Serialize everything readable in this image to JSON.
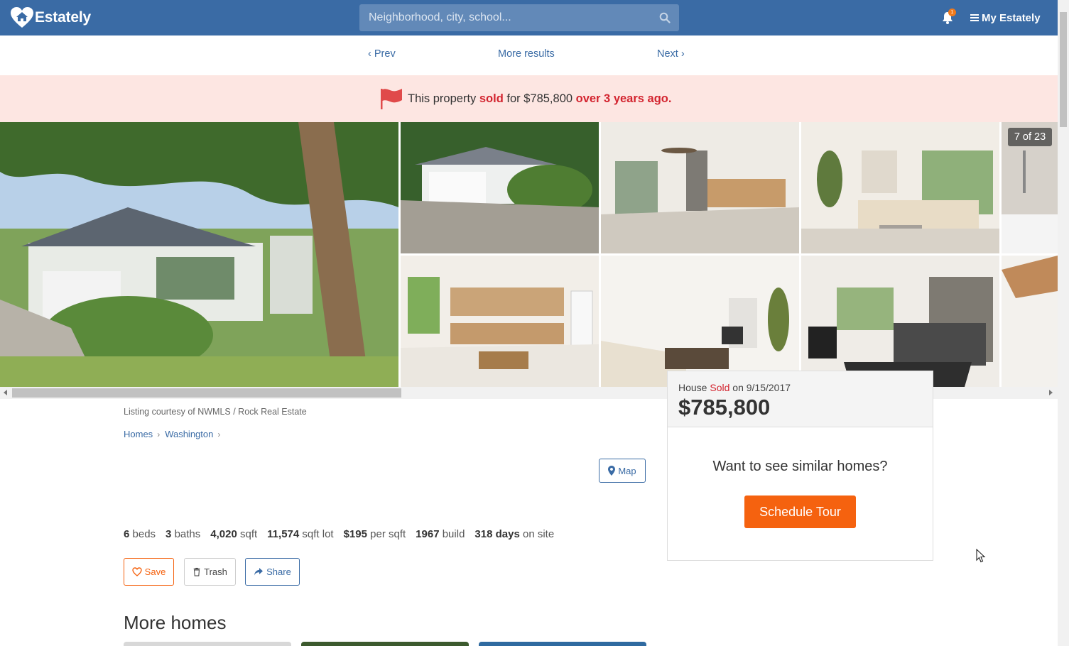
{
  "header": {
    "logo_text": "Estately",
    "search_placeholder": "Neighborhood, city, school...",
    "notification_count": "1",
    "menu_label": "My Estately",
    "brand_color": "#3a6ba5"
  },
  "pager": {
    "prev": "Prev",
    "more": "More results",
    "next": "Next"
  },
  "banner": {
    "pre": "This property ",
    "sold_word": "sold",
    "mid": " for $785,800 ",
    "ago": "over 3 years ago."
  },
  "gallery": {
    "counter": "7 of 23",
    "icons": [
      "flag-icon"
    ]
  },
  "listing": {
    "courtesy": "Listing courtesy of NWMLS / Rock Real Estate",
    "breadcrumbs": [
      "Homes",
      "Washington"
    ],
    "map_label": "Map",
    "facts": [
      {
        "value": "6",
        "label": "beds"
      },
      {
        "value": "3",
        "label": "baths"
      },
      {
        "value": "4,020",
        "label": "sqft"
      },
      {
        "value": "11,574",
        "label": "sqft lot"
      },
      {
        "value": "$195",
        "label": "per sqft"
      },
      {
        "value": "1967",
        "label": "build"
      },
      {
        "value": "318 days",
        "label": "on site"
      }
    ],
    "actions": {
      "save": "Save",
      "trash": "Trash",
      "share": "Share"
    },
    "more_homes": "More homes"
  },
  "sold_card": {
    "type": "House",
    "status": "Sold",
    "date_text": "on 9/15/2017",
    "price": "$785,800",
    "prompt": "Want to see similar homes?",
    "cta": "Schedule Tour",
    "cta_color": "#f5620f"
  }
}
